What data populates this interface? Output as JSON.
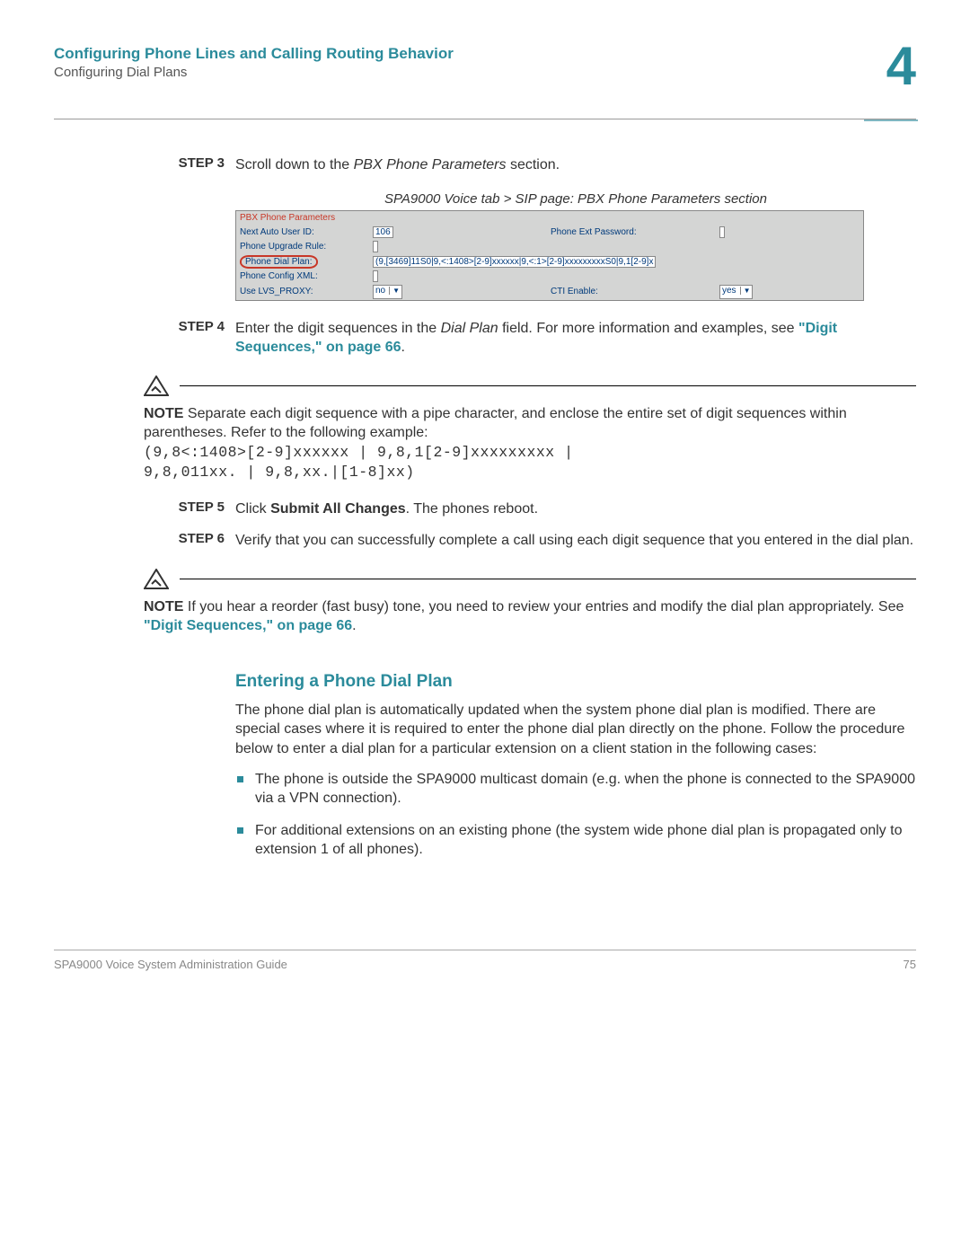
{
  "header": {
    "chapter_title": "Configuring Phone Lines and Calling Routing Behavior",
    "chapter_subtitle": "Configuring Dial Plans",
    "chapter_number": "4"
  },
  "steps": {
    "s3": {
      "label": "STEP 3",
      "text_before_em": "Scroll down to the ",
      "em": "PBX Phone Parameters",
      "text_after_em": " section."
    },
    "caption": "SPA9000 Voice tab > SIP page: PBX Phone Parameters section",
    "screenshot": {
      "section": "PBX Phone Parameters",
      "rows": [
        {
          "l1": "Next Auto User ID:",
          "v1": "106",
          "l2": "Phone Ext Password:",
          "v2": ""
        },
        {
          "l1": "Phone Upgrade Rule:",
          "v1": "",
          "l2": "",
          "v2": ""
        }
      ],
      "dialplan_label": "Phone Dial Plan:",
      "dialplan_value": "(9,[3469]11S0|9,<:1408>[2-9]xxxxxx|9,<:1>[2-9]xxxxxxxxxS0|9,1[2-9]x",
      "config_label": "Phone Config XML:",
      "lvs_label": "Use LVS_PROXY:",
      "lvs_value": "no",
      "cti_label": "CTI Enable:",
      "cti_value": "yes"
    },
    "s4": {
      "label": "STEP 4",
      "t1": "Enter the digit sequences in the ",
      "em": "Dial Plan",
      "t2": " field. For more information and examples, see ",
      "link": "\"Digit Sequences,\" on page 66",
      "t3": "."
    },
    "note1": {
      "label": "NOTE",
      "text_full": "Separate each digit sequence with a pipe character, and enclose the entire set of digit sequences within parentheses. Refer to the following example:",
      "code1": "(9,8<:1408>[2-9]xxxxxx | 9,8,1[2-9]xxxxxxxxx |",
      "code2": "9,8,011xx. | 9,8,xx.|[1-8]xx)"
    },
    "s5": {
      "label": "STEP 5",
      "t1": "Click ",
      "bold": "Submit All Changes",
      "t2": ". The phones reboot."
    },
    "s6": {
      "label": "STEP 6",
      "text": "Verify that you can successfully complete a call using each digit sequence that you entered in the dial plan."
    },
    "note2": {
      "label": "NOTE",
      "t1": "If you hear a reorder (fast busy) tone, you need to review your entries and modify the dial plan appropriately. See ",
      "link": "\"Digit Sequences,\" on page 66",
      "t2": "."
    }
  },
  "section": {
    "heading": "Entering a Phone Dial Plan",
    "para": "The phone dial plan is automatically updated when the system phone dial plan is modified. There are special cases where it is required to enter the phone dial plan directly on the phone. Follow the procedure below to enter a dial plan for a particular extension on a client station in the following cases:",
    "bullets": [
      "The phone is outside the SPA9000 multicast domain (e.g. when the phone is connected to the SPA9000 via a VPN connection).",
      "For additional extensions on an existing phone (the system wide phone dial plan is propagated only to extension 1 of all phones)."
    ]
  },
  "footer": {
    "left": "SPA9000 Voice System Administration Guide",
    "right": "75"
  }
}
